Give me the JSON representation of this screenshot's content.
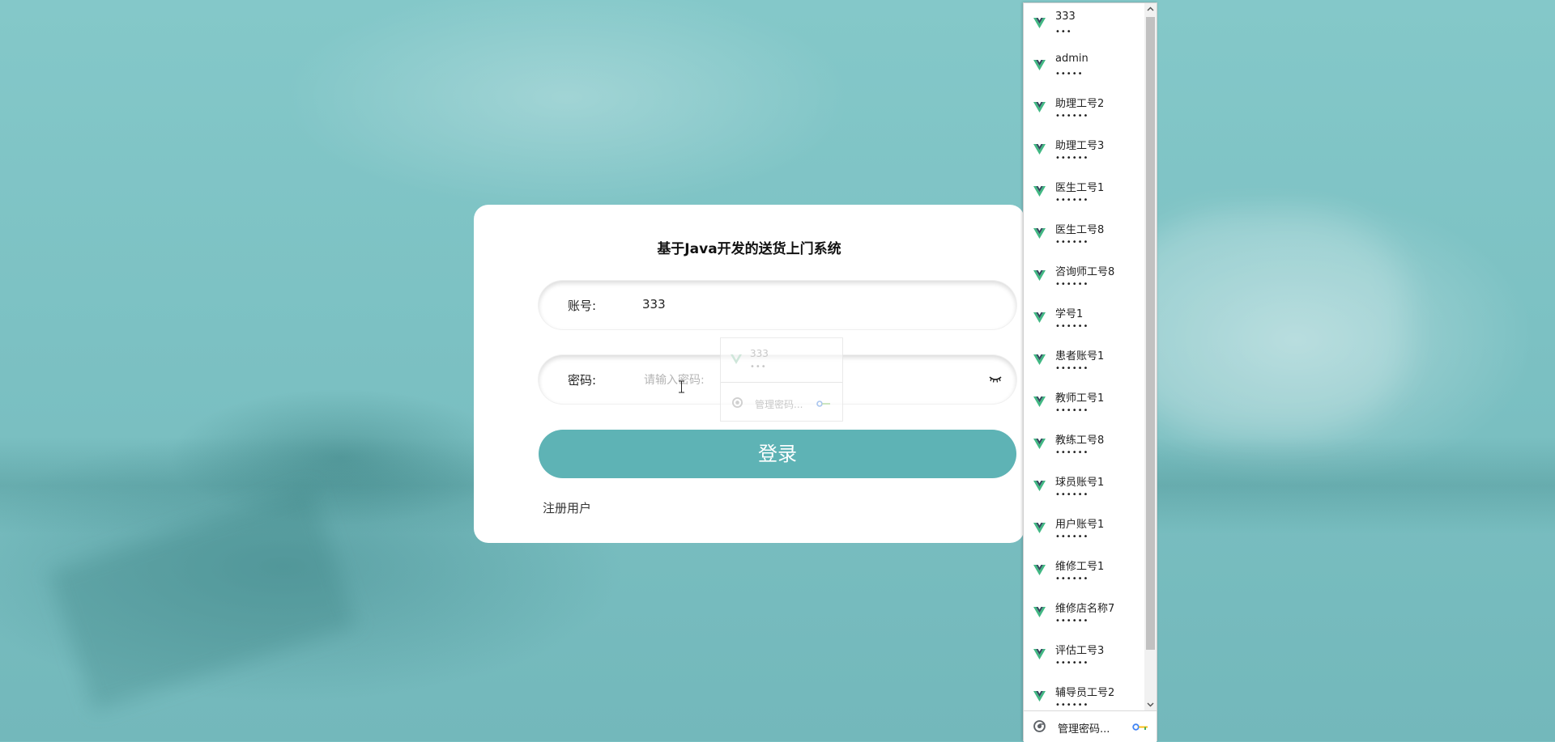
{
  "login": {
    "title": "基于Java开发的送货上门系统",
    "account_label": "账号:",
    "account_value": "333",
    "password_label": "密码:",
    "password_placeholder": "请输入密码:",
    "login_button": "登录",
    "register_link": "注册用户"
  },
  "ghost_popup": {
    "username": "333",
    "dots": "•••",
    "manage_label": "管理密码..."
  },
  "autofill": {
    "items": [
      {
        "username": "333",
        "password_mask": "•••"
      },
      {
        "username": "admin",
        "password_mask": "•••••"
      },
      {
        "username": "助理工号2",
        "password_mask": "••••••"
      },
      {
        "username": "助理工号3",
        "password_mask": "••••••"
      },
      {
        "username": "医生工号1",
        "password_mask": "••••••"
      },
      {
        "username": "医生工号8",
        "password_mask": "••••••"
      },
      {
        "username": "咨询师工号8",
        "password_mask": "••••••"
      },
      {
        "username": "学号1",
        "password_mask": "••••••"
      },
      {
        "username": "患者账号1",
        "password_mask": "••••••"
      },
      {
        "username": "教师工号1",
        "password_mask": "••••••"
      },
      {
        "username": "教练工号8",
        "password_mask": "••••••"
      },
      {
        "username": "球员账号1",
        "password_mask": "••••••"
      },
      {
        "username": "用户账号1",
        "password_mask": "••••••"
      },
      {
        "username": "维修工号1",
        "password_mask": "••••••"
      },
      {
        "username": "维修店名称7",
        "password_mask": "••••••"
      },
      {
        "username": "评估工号3",
        "password_mask": "••••••"
      },
      {
        "username": "辅导员工号2",
        "password_mask": "••••••"
      }
    ],
    "manage_label": "管理密码..."
  },
  "colors": {
    "accent": "#5eb3b5",
    "background": "#7cc2c4",
    "vue_green": "#41b883",
    "vue_dark": "#35495e"
  }
}
